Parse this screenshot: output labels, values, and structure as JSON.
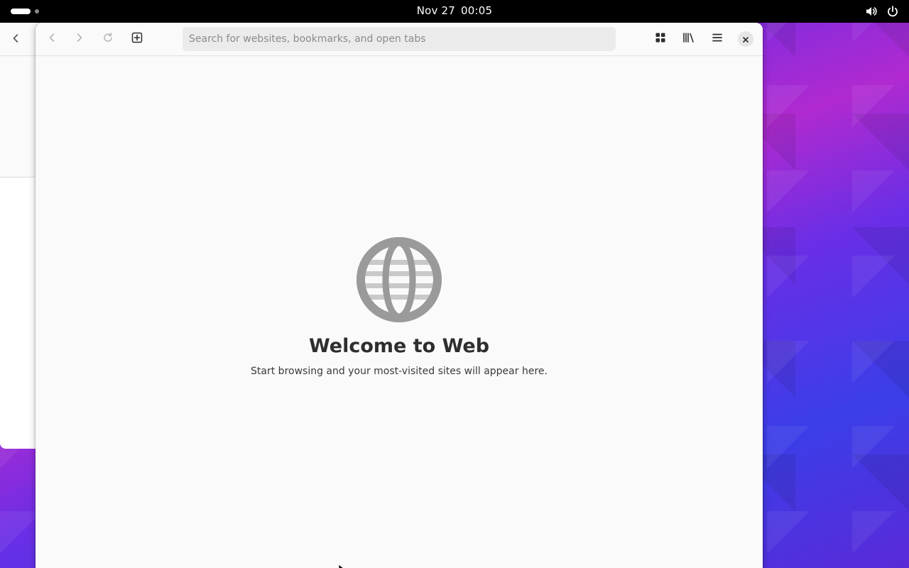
{
  "topbar": {
    "date": "Nov 27",
    "time": "00:05",
    "icons": [
      "volume-icon",
      "power-icon"
    ]
  },
  "browser": {
    "toolbar": {
      "back_icon": "chevron-left-icon",
      "forward_icon": "chevron-right-icon",
      "reload_icon": "reload-icon",
      "new_tab_icon": "new-tab-icon",
      "search_placeholder": "Search for websites, bookmarks, and open tabs",
      "search_value": "",
      "tab_overview_icon": "grid-icon",
      "library_icon": "library-icon",
      "menu_icon": "hamburger-menu-icon",
      "close_icon": "close-icon"
    },
    "welcome": {
      "icon": "globe-icon",
      "title": "Welcome to Web",
      "subtitle": "Start browsing and your most-visited sites will appear here."
    }
  },
  "colors": {
    "topbar_bg": "#000000",
    "window_bg": "#fafafa",
    "entry_bg": "#ebebeb",
    "globe_gray": "#9a9a9a",
    "wallpaper_accent": "#7b2ce0"
  }
}
